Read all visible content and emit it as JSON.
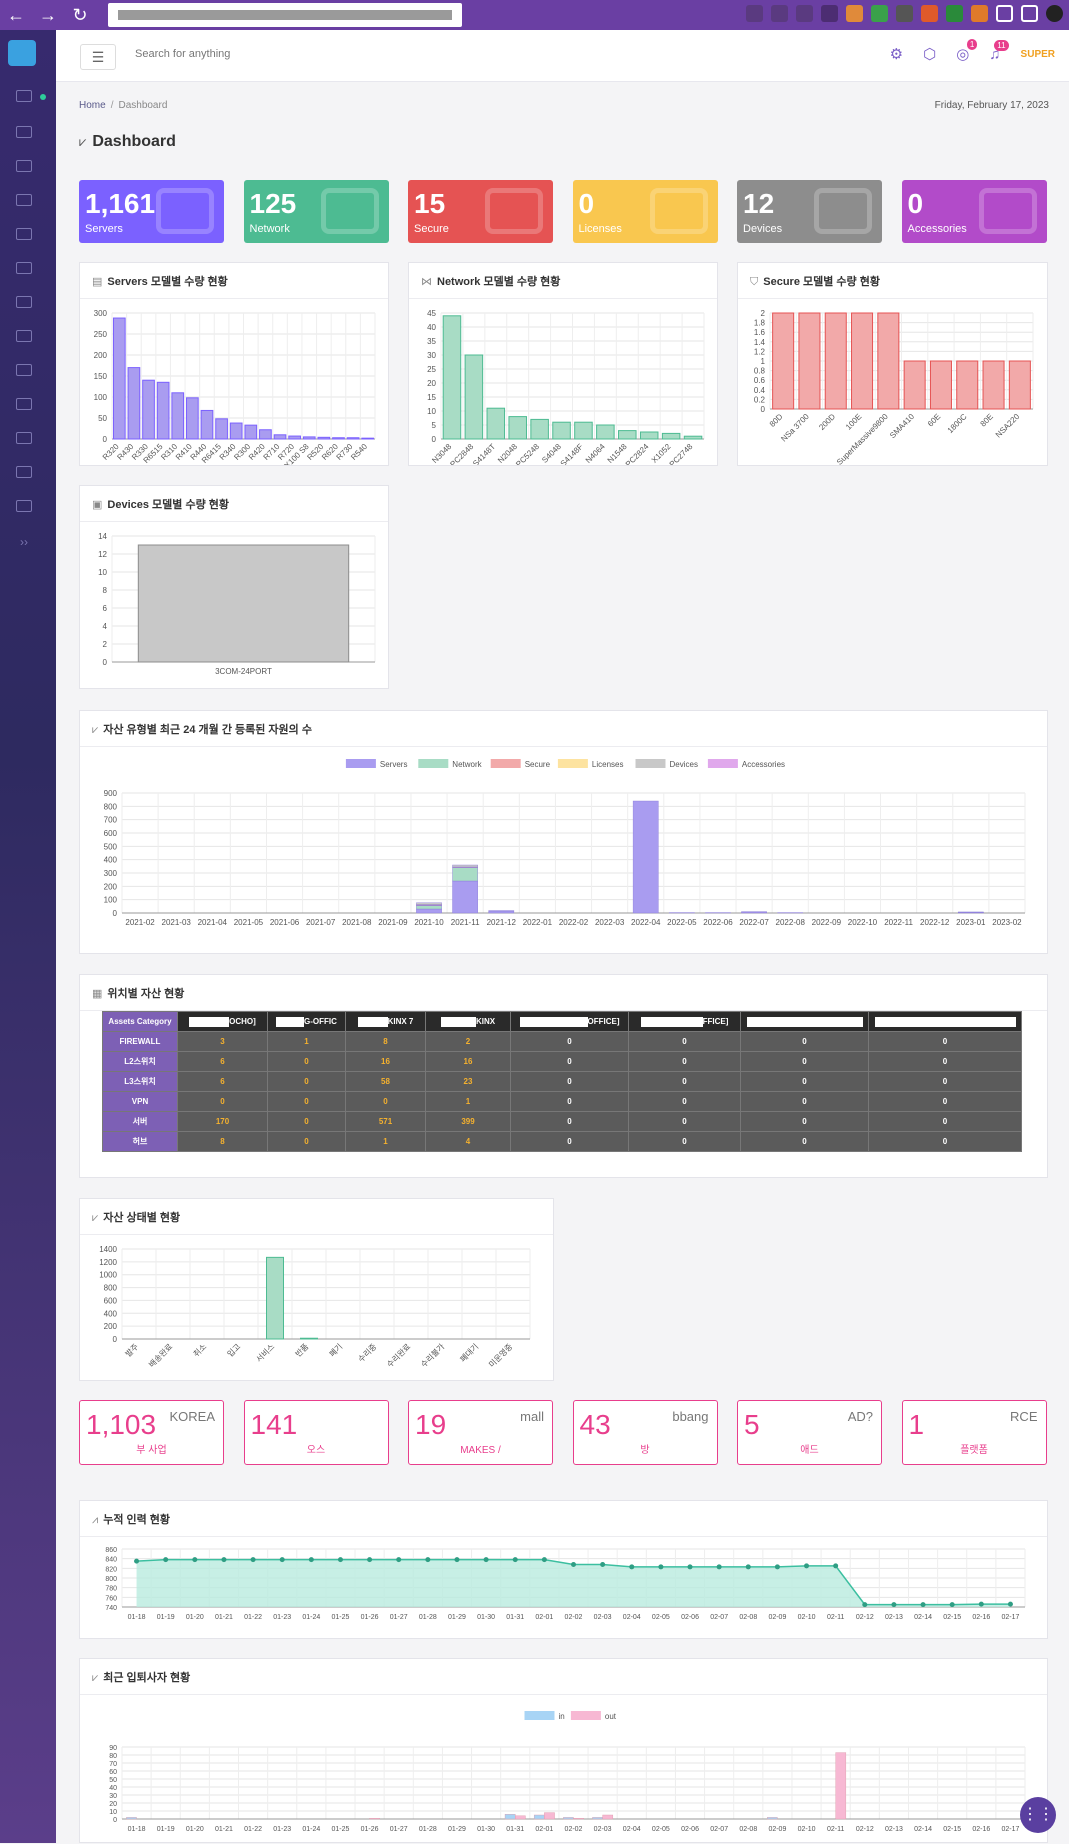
{
  "topbar": {
    "search_placeholder": "Search for anything",
    "user": "SUPER",
    "notif_globe": "1",
    "notif_bell": "11"
  },
  "breadcrumb": {
    "home": "Home",
    "current": "Dashboard"
  },
  "date": "Friday, February 17, 2023",
  "page_title": "Dashboard",
  "stats": [
    {
      "value": "1,161",
      "label": "Servers",
      "color": "#7b61ff"
    },
    {
      "value": "125",
      "label": "Network",
      "color": "#4dbb92"
    },
    {
      "value": "15",
      "label": "Secure",
      "color": "#e55353"
    },
    {
      "value": "0",
      "label": "Licenses",
      "color": "#f9c74f"
    },
    {
      "value": "12",
      "label": "Devices",
      "color": "#8d8d8d"
    },
    {
      "value": "0",
      "label": "Accessories",
      "color": "#b24bc9"
    }
  ],
  "cards": {
    "servers": "Servers 모델별 수량 현황",
    "network": "Network 모델별 수량 현황",
    "secure": "Secure 모델별 수량 현황",
    "devices": "Devices 모델별 수량 현황",
    "monthly": "자산 유형별 최근 24 개월 간 등록된 자원의 수",
    "location": "위치별 자산 현황",
    "status": "자산 상태별 현황",
    "cumulative": "누적 인력 현황",
    "recent": "최근 입퇴사자 현황"
  },
  "location_table": {
    "header": [
      "Assets Category",
      "OCHO]",
      "G-OFFIC",
      "KINX 7",
      "KINX",
      "OFFICE]",
      "FFICE]",
      "",
      ""
    ],
    "rows": [
      {
        "cat": "FIREWALL",
        "vals": [
          "3",
          "1",
          "8",
          "2",
          "0",
          "0",
          "0",
          "0"
        ]
      },
      {
        "cat": "L2스위치",
        "vals": [
          "6",
          "0",
          "16",
          "16",
          "0",
          "0",
          "0",
          "0"
        ]
      },
      {
        "cat": "L3스위치",
        "vals": [
          "6",
          "0",
          "58",
          "23",
          "0",
          "0",
          "0",
          "0"
        ]
      },
      {
        "cat": "VPN",
        "vals": [
          "0",
          "0",
          "0",
          "1",
          "0",
          "0",
          "0",
          "0"
        ]
      },
      {
        "cat": "서버",
        "vals": [
          "170",
          "0",
          "571",
          "399",
          "0",
          "0",
          "0",
          "0"
        ]
      },
      {
        "cat": "허브",
        "vals": [
          "8",
          "0",
          "1",
          "4",
          "0",
          "0",
          "0",
          "0"
        ]
      }
    ]
  },
  "people_cards": [
    {
      "value": "1,103",
      "tag": "KOREA",
      "sub": "부          사업"
    },
    {
      "value": "141",
      "tag": "",
      "sub": "오스"
    },
    {
      "value": "19",
      "tag": "mall",
      "sub": "MAKES            /"
    },
    {
      "value": "43",
      "tag": "bbang",
      "sub": "방"
    },
    {
      "value": "5",
      "tag": "AD?",
      "sub": "애드"
    },
    {
      "value": "1",
      "tag": "RCE",
      "sub": "플랫폼"
    }
  ],
  "chart_data": [
    {
      "id": "servers",
      "type": "bar",
      "color": "#a99cf0",
      "stroke": "#7b61ff",
      "categories": [
        "R320",
        "R430",
        "R330",
        "R6515",
        "R310",
        "R410",
        "R440",
        "R6415",
        "R340",
        "R300",
        "R420",
        "R710",
        "R720",
        "RX100 S8",
        "R520",
        "R620",
        "R730",
        "R540"
      ],
      "values": [
        288,
        170,
        140,
        135,
        110,
        98,
        68,
        48,
        38,
        33,
        22,
        10,
        7,
        5,
        4,
        3,
        3,
        2
      ],
      "ylim": [
        0,
        300
      ],
      "ticks": [
        0,
        50,
        100,
        150,
        200,
        250,
        300
      ]
    },
    {
      "id": "network",
      "type": "bar",
      "color": "#a8dcc5",
      "stroke": "#4dbb92",
      "categories": [
        "N3048",
        "PC2848",
        "S4148T",
        "N2048",
        "PC5248",
        "S4048",
        "S4148F",
        "N4064",
        "N1548",
        "PC2824",
        "X1052",
        "PC2748"
      ],
      "values": [
        44,
        30,
        11,
        8,
        7,
        6,
        6,
        5,
        3,
        2.5,
        2,
        1
      ],
      "ylim": [
        0,
        45
      ],
      "ticks": [
        0,
        5,
        10,
        15,
        20,
        25,
        30,
        35,
        40,
        45
      ]
    },
    {
      "id": "secure",
      "type": "bar",
      "color": "#f2a9a9",
      "stroke": "#e55353",
      "categories": [
        "80D",
        "NSa 3700",
        "200D",
        "100E",
        "SuperMassive9800",
        "SMA410",
        "60E",
        "1800C",
        "80E",
        "NSA220"
      ],
      "values": [
        2,
        2,
        2,
        2,
        2,
        1,
        1,
        1,
        1,
        1
      ],
      "ylim": [
        0,
        2
      ],
      "ticks": [
        0,
        0.2,
        0.4,
        0.6,
        0.8,
        1,
        1.2,
        1.4,
        1.6,
        1.8,
        2
      ]
    },
    {
      "id": "devices",
      "type": "bar",
      "color": "#c8c8c8",
      "stroke": "#8d8d8d",
      "categories": [
        "3COM-24PORT"
      ],
      "values": [
        13
      ],
      "ylim": [
        0,
        14
      ],
      "ticks": [
        0,
        2,
        4,
        6,
        8,
        10,
        12,
        14
      ]
    },
    {
      "id": "monthly",
      "type": "bar",
      "categories": [
        "2021-02",
        "2021-03",
        "2021-04",
        "2021-05",
        "2021-06",
        "2021-07",
        "2021-08",
        "2021-09",
        "2021-10",
        "2021-11",
        "2021-12",
        "2022-01",
        "2022-02",
        "2022-03",
        "2022-04",
        "2022-05",
        "2022-06",
        "2022-07",
        "2022-08",
        "2022-09",
        "2022-10",
        "2022-11",
        "2022-12",
        "2023-01",
        "2023-02"
      ],
      "series": [
        {
          "name": "Servers",
          "color": "#a99cf0",
          "values": [
            0,
            0,
            0,
            0,
            0,
            0,
            0,
            0,
            30,
            240,
            15,
            0,
            0,
            0,
            840,
            3,
            3,
            8,
            3,
            0,
            0,
            0,
            0,
            5,
            0
          ]
        },
        {
          "name": "Network",
          "color": "#a8dcc5",
          "values": [
            0,
            0,
            0,
            0,
            0,
            0,
            0,
            0,
            25,
            100,
            3,
            0,
            0,
            0,
            0,
            0,
            0,
            2,
            0,
            0,
            0,
            0,
            0,
            3,
            0
          ]
        },
        {
          "name": "Secure",
          "color": "#f2a9a9",
          "values": [
            0,
            0,
            0,
            0,
            0,
            0,
            0,
            0,
            5,
            5,
            0,
            0,
            0,
            0,
            0,
            0,
            0,
            0,
            0,
            0,
            0,
            0,
            0,
            0,
            0
          ]
        },
        {
          "name": "Licenses",
          "color": "#fde3a0",
          "values": [
            0,
            0,
            0,
            0,
            0,
            0,
            0,
            0,
            5,
            0,
            0,
            0,
            0,
            0,
            0,
            0,
            0,
            0,
            0,
            0,
            0,
            0,
            0,
            0,
            0
          ]
        },
        {
          "name": "Devices",
          "color": "#c8c8c8",
          "values": [
            0,
            0,
            0,
            0,
            0,
            0,
            0,
            0,
            12,
            15,
            0,
            0,
            0,
            0,
            0,
            0,
            0,
            0,
            0,
            0,
            0,
            0,
            0,
            0,
            0
          ]
        },
        {
          "name": "Accessories",
          "color": "#e0a8ec",
          "values": [
            0,
            0,
            0,
            0,
            0,
            0,
            0,
            0,
            0,
            0,
            0,
            0,
            0,
            0,
            0,
            0,
            0,
            0,
            0,
            0,
            0,
            0,
            0,
            0,
            0
          ]
        }
      ],
      "ylim": [
        0,
        900
      ],
      "ticks": [
        0,
        100,
        200,
        300,
        400,
        500,
        600,
        700,
        800,
        900
      ]
    },
    {
      "id": "status",
      "type": "bar",
      "color": "#a8dcc5",
      "stroke": "#4dbb92",
      "categories": [
        "발주",
        "배송완료",
        "취소",
        "입고",
        "서비스",
        "반품",
        "폐기",
        "수리중",
        "수리완료",
        "수리불가",
        "폐대기",
        "미운영중"
      ],
      "values": [
        0,
        0,
        0,
        0,
        1270,
        12,
        0,
        0,
        0,
        0,
        0,
        0
      ],
      "ylim": [
        0,
        1400
      ],
      "ticks": [
        0,
        200,
        400,
        600,
        800,
        1000,
        1200,
        1400
      ]
    },
    {
      "id": "cumulative",
      "type": "line",
      "color": "#3cbfa0",
      "categories": [
        "01-18",
        "01-19",
        "01-20",
        "01-21",
        "01-22",
        "01-23",
        "01-24",
        "01-25",
        "01-26",
        "01-27",
        "01-28",
        "01-29",
        "01-30",
        "01-31",
        "02-01",
        "02-02",
        "02-03",
        "02-04",
        "02-05",
        "02-06",
        "02-07",
        "02-08",
        "02-09",
        "02-10",
        "02-11",
        "02-12",
        "02-13",
        "02-14",
        "02-15",
        "02-16",
        "02-17"
      ],
      "values": [
        835,
        838,
        838,
        838,
        838,
        838,
        838,
        838,
        838,
        838,
        838,
        838,
        838,
        838,
        838,
        828,
        828,
        823,
        823,
        823,
        823,
        823,
        823,
        825,
        825,
        745,
        745,
        745,
        745,
        746,
        746
      ],
      "ylim": [
        740,
        860
      ],
      "ticks": [
        740,
        760,
        780,
        800,
        820,
        840,
        860
      ]
    },
    {
      "id": "recent",
      "type": "bar",
      "categories": [
        "01-18",
        "01-19",
        "01-20",
        "01-21",
        "01-22",
        "01-23",
        "01-24",
        "01-25",
        "01-26",
        "01-27",
        "01-28",
        "01-29",
        "01-30",
        "01-31",
        "02-01",
        "02-02",
        "02-03",
        "02-04",
        "02-05",
        "02-06",
        "02-07",
        "02-08",
        "02-09",
        "02-10",
        "02-11",
        "02-12",
        "02-13",
        "02-14",
        "02-15",
        "02-16",
        "02-17"
      ],
      "series": [
        {
          "name": "in",
          "color": "#a8d4f5",
          "values": [
            2,
            0,
            0,
            0,
            0,
            0,
            0,
            0,
            0,
            0,
            0,
            0,
            0,
            6,
            5,
            2,
            2,
            0,
            0,
            0,
            0,
            0,
            2,
            0,
            0,
            0,
            0,
            0,
            0,
            0,
            0
          ]
        },
        {
          "name": "out",
          "color": "#f7b8d3",
          "values": [
            0,
            0,
            0,
            0,
            0,
            0,
            0,
            0,
            1,
            0,
            0,
            0,
            0,
            4,
            8,
            1,
            5,
            0,
            0,
            0,
            0,
            0,
            0,
            0,
            83,
            0,
            0,
            0,
            0,
            0,
            0
          ]
        }
      ],
      "ylim": [
        0,
        90
      ],
      "ticks": [
        0,
        10,
        20,
        30,
        40,
        50,
        60,
        70,
        80,
        90
      ]
    }
  ]
}
